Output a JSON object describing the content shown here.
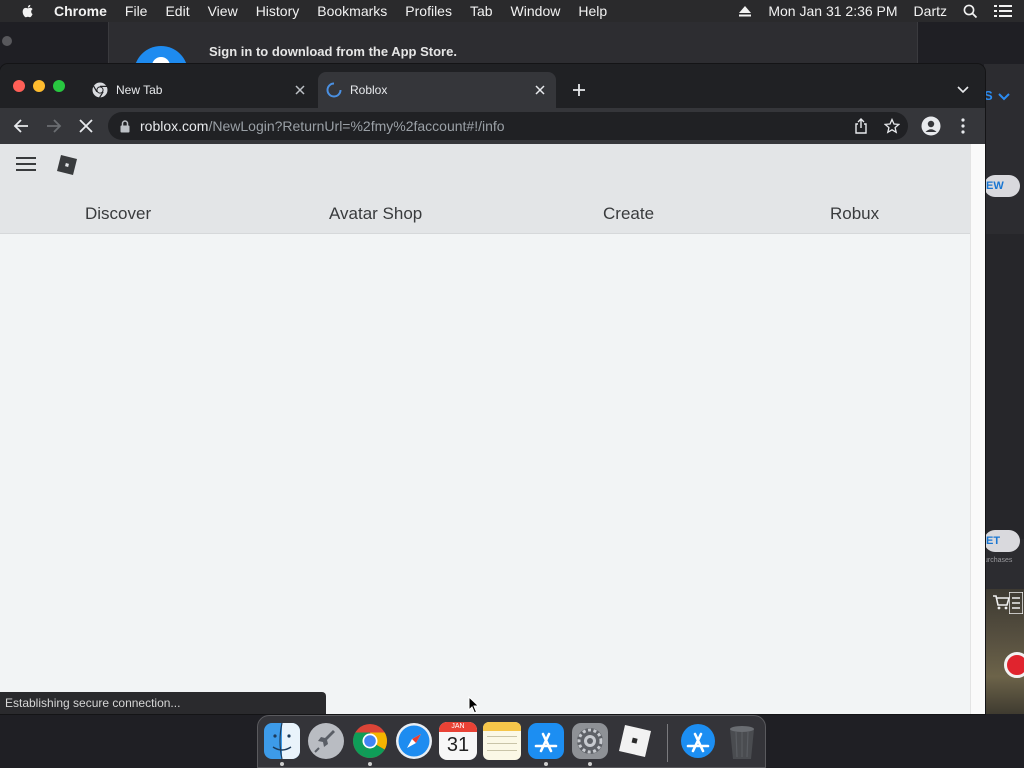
{
  "menubar": {
    "app": "Chrome",
    "items": [
      "File",
      "Edit",
      "View",
      "History",
      "Bookmarks",
      "Profiles",
      "Tab",
      "Window",
      "Help"
    ],
    "clock": "Mon Jan 31  2:36 PM",
    "user": "Dartz"
  },
  "appstore": {
    "signin_text": "Sign in to download from the App Store."
  },
  "background_window": {
    "header_fragment": "S",
    "button_fragment_1": "EW",
    "button_fragment_2": "ET",
    "caption_fragment": "urchases"
  },
  "browser": {
    "tabs": [
      {
        "title": "New Tab",
        "icon": "chrome-icon"
      },
      {
        "title": "Roblox",
        "icon": "loading-spinner-icon",
        "active": true
      }
    ],
    "address": {
      "host": "roblox.com",
      "path": "/NewLogin?ReturnUrl=%2fmy%2faccount#!/info"
    },
    "status_text": "Establishing secure connection..."
  },
  "page": {
    "nav": [
      "Discover",
      "Avatar Shop",
      "Create",
      "Robux"
    ]
  },
  "dock": {
    "apps": [
      "Finder",
      "Launchpad",
      "Google Chrome",
      "Safari",
      "Calendar",
      "Notes",
      "App Store",
      "System Preferences",
      "Roblox",
      "App Store Downloads",
      "Trash"
    ],
    "calendar_month": "JAN",
    "calendar_day": "31"
  },
  "colors": {
    "chrome_frame": "#202124",
    "toolbar": "#35363a",
    "page_bg": "#f2f4f5",
    "roblox_header": "#e3e5e7",
    "link_blue": "#2b8cf2"
  }
}
